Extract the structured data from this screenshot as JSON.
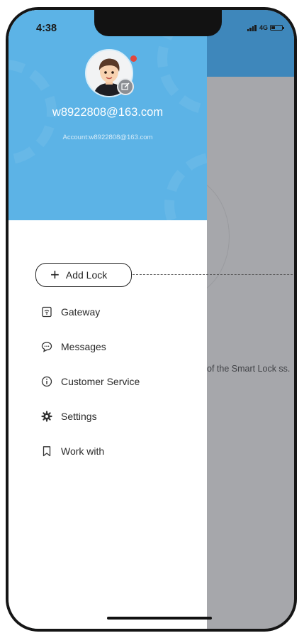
{
  "status_bar": {
    "time": "4:38",
    "network": "4G"
  },
  "profile": {
    "email": "w8922808@163.com",
    "account": "Account:w8922808@163.com"
  },
  "menu": {
    "add_lock": {
      "label": "Add Lock",
      "icon": "plus-icon"
    },
    "items": [
      {
        "label": "Gateway",
        "icon": "gateway-icon"
      },
      {
        "label": "Messages",
        "icon": "message-icon"
      },
      {
        "label": "Customer Service",
        "icon": "info-icon"
      },
      {
        "label": "Settings",
        "icon": "gear-icon"
      },
      {
        "label": "Work with",
        "icon": "bookmark-icon"
      }
    ]
  },
  "background_page": {
    "partial_text": "of the Smart Lock ss."
  },
  "colors": {
    "drawer_header": "#5cb3e6",
    "page_header": "#3e87bb",
    "overlay": "#a6a7ab"
  }
}
